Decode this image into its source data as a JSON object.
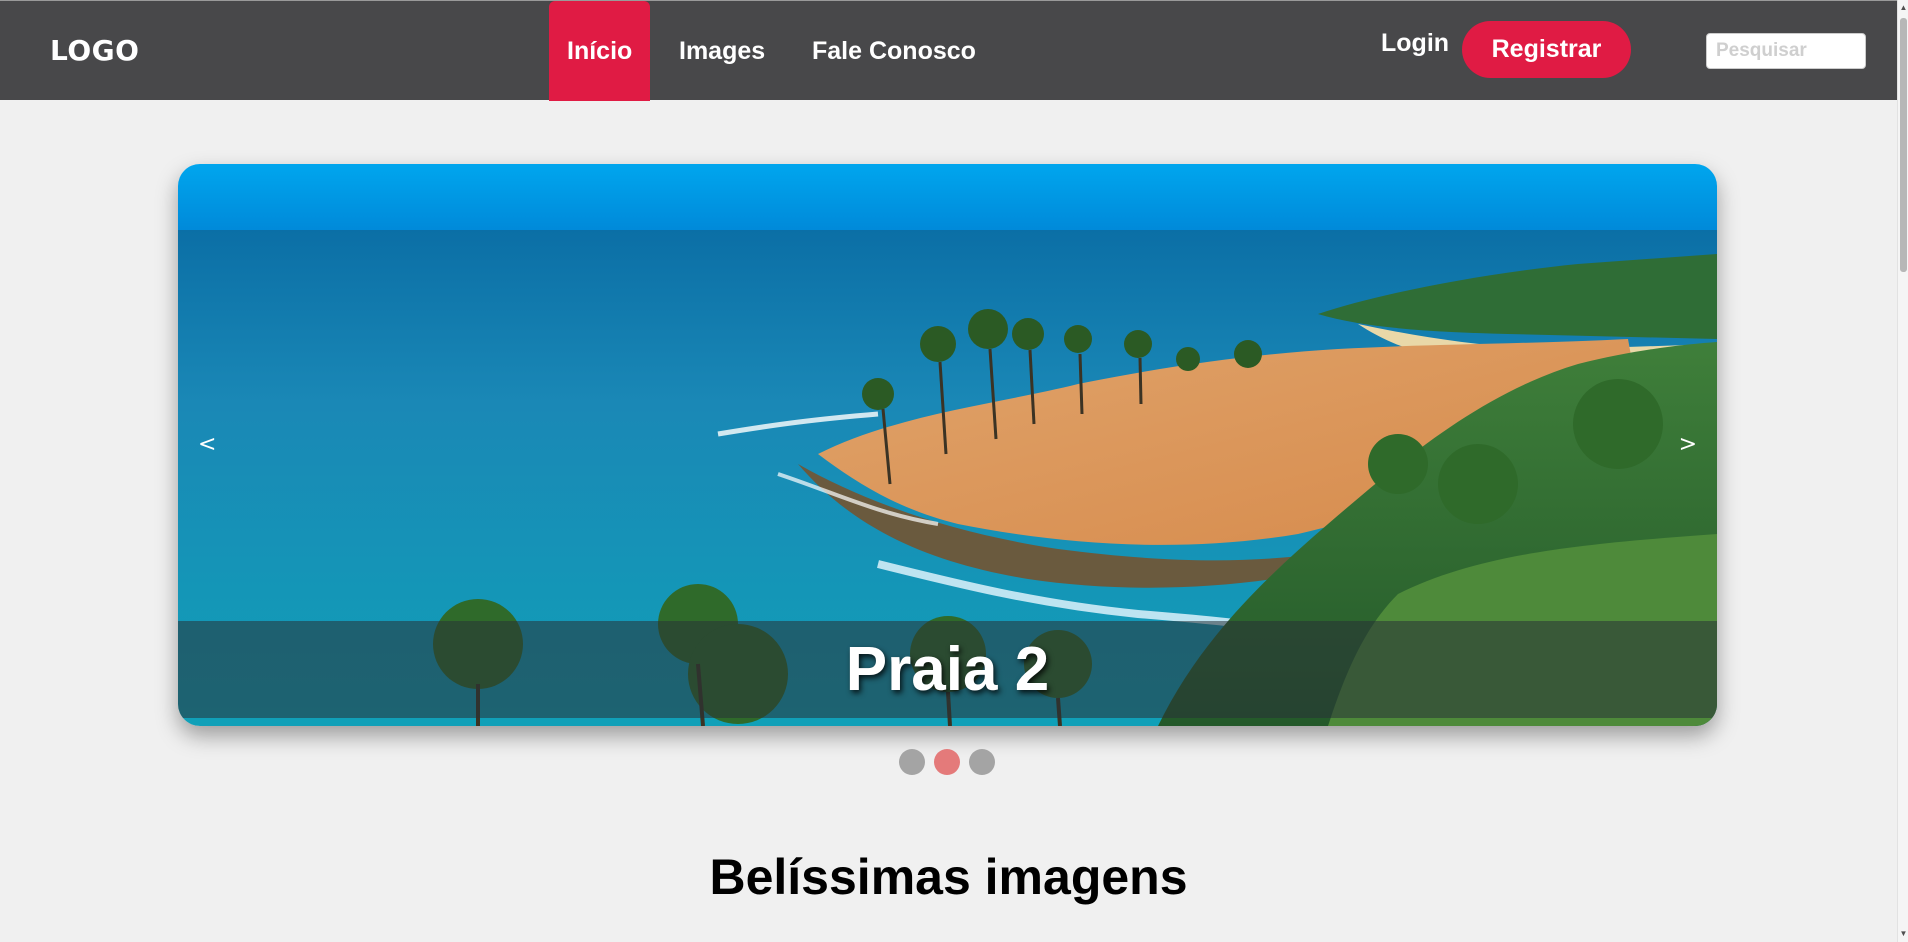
{
  "header": {
    "logo": "LOGO",
    "nav": [
      {
        "label": "Início",
        "active": true
      },
      {
        "label": "Images",
        "active": false
      },
      {
        "label": "Fale Conosco",
        "active": false
      }
    ],
    "login_label": "Login",
    "register_label": "Registrar",
    "search_placeholder": "Pesquisar"
  },
  "carousel": {
    "caption": "Praia 2",
    "prev_symbol": "<",
    "next_symbol": ">",
    "image_icon": "beach-image",
    "active_slide": 2,
    "slide_count": 3
  },
  "section": {
    "title": "Belíssimas imagens"
  },
  "colors": {
    "navbar": "#48484a",
    "accent": "#e01b44",
    "dot_active": "#e47a7a",
    "dot_inactive": "#a4a4a4",
    "page_bg": "#f0f0f0"
  }
}
